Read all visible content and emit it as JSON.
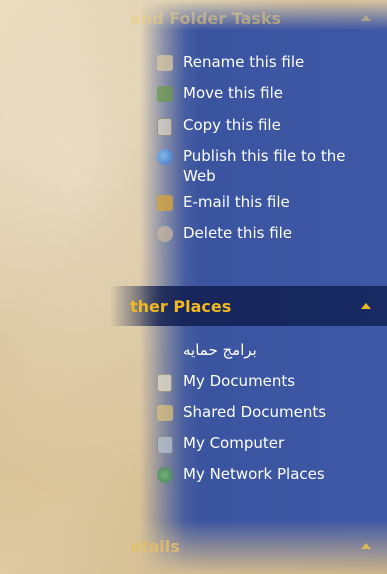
{
  "file_tasks": {
    "header": "and Folder Tasks",
    "items": [
      {
        "label": "Rename this file",
        "icon": "rename-icon"
      },
      {
        "label": "Move this file",
        "icon": "move-icon"
      },
      {
        "label": "Copy this file",
        "icon": "copy-icon"
      },
      {
        "label": "Publish this file to the Web",
        "icon": "publish-web-icon"
      },
      {
        "label": "E-mail this file",
        "icon": "email-icon"
      },
      {
        "label": "Delete this file",
        "icon": "delete-icon"
      }
    ]
  },
  "other_places": {
    "header": "ther Places",
    "items": [
      {
        "label": "برامج حمايه",
        "icon": "folder-icon"
      },
      {
        "label": "My Documents",
        "icon": "my-documents-icon"
      },
      {
        "label": "Shared Documents",
        "icon": "shared-documents-icon"
      },
      {
        "label": "My Computer",
        "icon": "my-computer-icon"
      },
      {
        "label": "My Network Places",
        "icon": "network-places-icon"
      }
    ]
  },
  "details": {
    "header": "etails"
  },
  "colors": {
    "pane_blue": "#3a54a0",
    "header_dark": "#17255a",
    "header_text": "#f0b821",
    "item_text": "#ffffff"
  }
}
